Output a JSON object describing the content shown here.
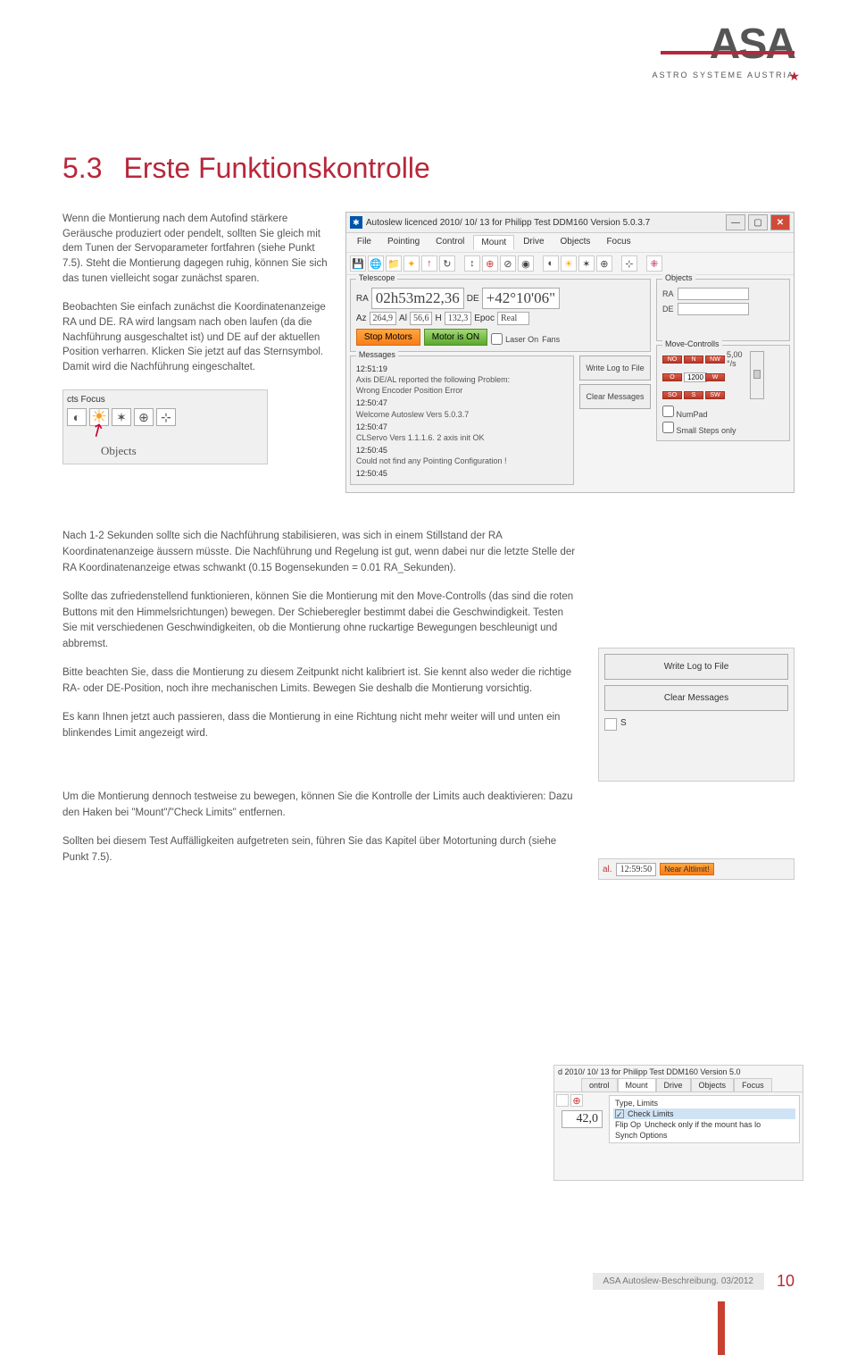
{
  "logo": {
    "brand": "ASA",
    "subtitle": "ASTRO SYSTEME AUSTRIA"
  },
  "heading": {
    "number": "5.3",
    "title": "Erste Funktionskontrolle"
  },
  "intro": {
    "p1": "Wenn die Montierung nach dem Autofind stärkere Geräusche produziert oder pendelt, sollten Sie gleich mit dem Tunen der Servoparameter fortfahren (siehe Punkt 7.5). Steht die Montierung dagegen ruhig, können Sie sich das tunen vielleicht sogar zunächst sparen.",
    "p2": "Beobachten Sie einfach zunächst die Koordinatenanzeige RA und DE. RA wird langsam nach oben laufen (da die Nachführung ausgeschaltet ist) und DE auf der aktuellen Position verharren. Klicken Sie jetzt auf das Sternsymbol. Damit wird die Nachführung eingeschaltet."
  },
  "window": {
    "title": "Autoslew licenced  2010/ 10/ 13 for Philipp Test DDM160 Version 5.0.3.7",
    "menus": [
      "File",
      "Pointing",
      "Control",
      "Mount",
      "Drive",
      "Objects",
      "Focus"
    ],
    "telescope": {
      "label": "Telescope",
      "ra_lbl": "RA",
      "ra_val": "02h53m22,36",
      "de_lbl": "DE",
      "de_val": "+42°10'06\"",
      "az_lbl": "Az",
      "az_val": "264,9",
      "al_lbl": "Al",
      "al_val": "56,6",
      "h_lbl": "H",
      "h_val": "132,3",
      "epoc_lbl": "Epoc",
      "epoc_val": "Real"
    },
    "objects": {
      "label": "Objects",
      "ra_lbl": "RA",
      "de_lbl": "DE"
    },
    "buttons": {
      "stop": "Stop Motors",
      "motor": "Motor is ON",
      "laser": "Laser On",
      "fans": "Fans"
    },
    "messages": {
      "label": "Messages",
      "lines": [
        "12:51:19",
        "Axis DE/AL reported the following Problem:",
        "Wrong Encoder Position Error",
        "12:50:47",
        "Welcome Autoslew Vers 5.0.3.7",
        "12:50:47",
        "CLServo Vers 1.1.1.6.  2 axis init OK",
        "12:50:45",
        "Could not find any Pointing Configuration !",
        "12:50:45"
      ]
    },
    "move": {
      "label": "Move-Controlls",
      "no": "NO",
      "n": "N",
      "nw": "NW",
      "o": "O",
      "w": "W",
      "so": "SO",
      "s": "S",
      "sw": "SW",
      "speed": "5,00 °/s",
      "input": "1200",
      "write": "Write Log to File",
      "clear": "Clear Messages",
      "numpad": "NumPad",
      "small": "Small Steps only"
    }
  },
  "snippet_toolbar": {
    "row1": "cts    Focus",
    "objects_label": "Objects"
  },
  "body": {
    "p1": "Nach 1-2 Sekunden sollte sich die Nachführung stabilisieren, was sich in einem Stillstand der RA Koordinatenanzeige äussern müsste. Die Nachführung und Regelung ist gut, wenn dabei nur die letzte Stelle der RA Koordinatenanzeige etwas schwankt (0.15 Bogensekunden = 0.01 RA_Sekunden).",
    "p2": "Sollte das zufriedenstellend funktionieren, können Sie die Montierung mit den Move-Controlls (das sind die roten Buttons mit den Himmelsrichtungen) bewegen. Der Schieberegler bestimmt dabei die Geschwindigkeit. Testen Sie mit verschiedenen Geschwindigkeiten, ob die Montierung ohne ruckartige Bewegungen beschleunigt und abbremst.",
    "p3": "Bitte beachten Sie, dass die Montierung zu diesem Zeitpunkt nicht kalibriert ist. Sie kennt also weder die richtige RA- oder DE-Position, noch ihre mechanischen Limits. Bewegen Sie deshalb die Montierung vorsichtig.",
    "p4": "Es kann Ihnen jetzt auch passieren, dass die Montierung in eine Richtung nicht mehr weiter will und unten ein blinkendes Limit angezeigt wird.",
    "p5": "Um die Montierung dennoch testweise zu bewegen, können Sie die Kontrolle der Limits auch deaktivieren: Dazu den Haken bei \"Mount\"/\"Check Limits\" entfernen.",
    "p6": "Sollten bei diesem Test Auffälligkeiten aufgetreten sein, führen Sie das Kapitel über Motortuning durch (siehe Punkt 7.5)."
  },
  "snippet_write": {
    "write": "Write Log to File",
    "clear": "Clear Messages",
    "s_label": "S"
  },
  "snippet_limit": {
    "al": "al.",
    "time": "12:59:50",
    "badge": "Near Altlimit!"
  },
  "snippet_cl": {
    "title": "d 2010/ 10/ 13 for Philipp Test DDM160 Version 5.0",
    "tabs": [
      "ontrol",
      "Mount",
      "Drive",
      "Objects",
      "Focus"
    ],
    "items": [
      "Type, Limits",
      "Check Limits",
      "Flip Op",
      "Synch Options"
    ],
    "tooltip": "Uncheck only if the mount has lo",
    "coord": "42,0"
  },
  "footer": {
    "doc": "ASA Autoslew-Beschreibung. 03/2012",
    "page": "10"
  }
}
